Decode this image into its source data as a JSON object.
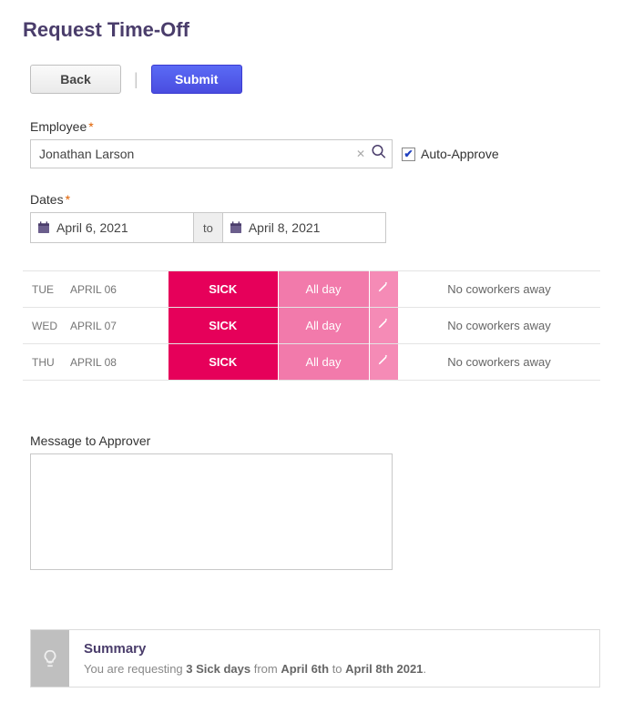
{
  "page": {
    "title": "Request Time-Off"
  },
  "buttons": {
    "back": "Back",
    "submit": "Submit"
  },
  "employee": {
    "label": "Employee",
    "value": "Jonathan Larson",
    "auto_approve_label": "Auto-Approve",
    "auto_approve_checked": true
  },
  "dates": {
    "label": "Dates",
    "start": "April 6, 2021",
    "to_label": "to",
    "end": "April 8, 2021"
  },
  "days": [
    {
      "dow": "TUE",
      "date": "APRIL 06",
      "type": "SICK",
      "duration": "All day",
      "note": "No coworkers away"
    },
    {
      "dow": "WED",
      "date": "APRIL 07",
      "type": "SICK",
      "duration": "All day",
      "note": "No coworkers away"
    },
    {
      "dow": "THU",
      "date": "APRIL 08",
      "type": "SICK",
      "duration": "All day",
      "note": "No coworkers away"
    }
  ],
  "message": {
    "label": "Message to Approver",
    "value": ""
  },
  "summary": {
    "heading": "Summary",
    "pre": "You are requesting ",
    "bold1": "3 Sick days",
    "mid1": " from ",
    "bold2": "April 6th",
    "mid2": " to ",
    "bold3": "April 8th 2021",
    "post": "."
  }
}
